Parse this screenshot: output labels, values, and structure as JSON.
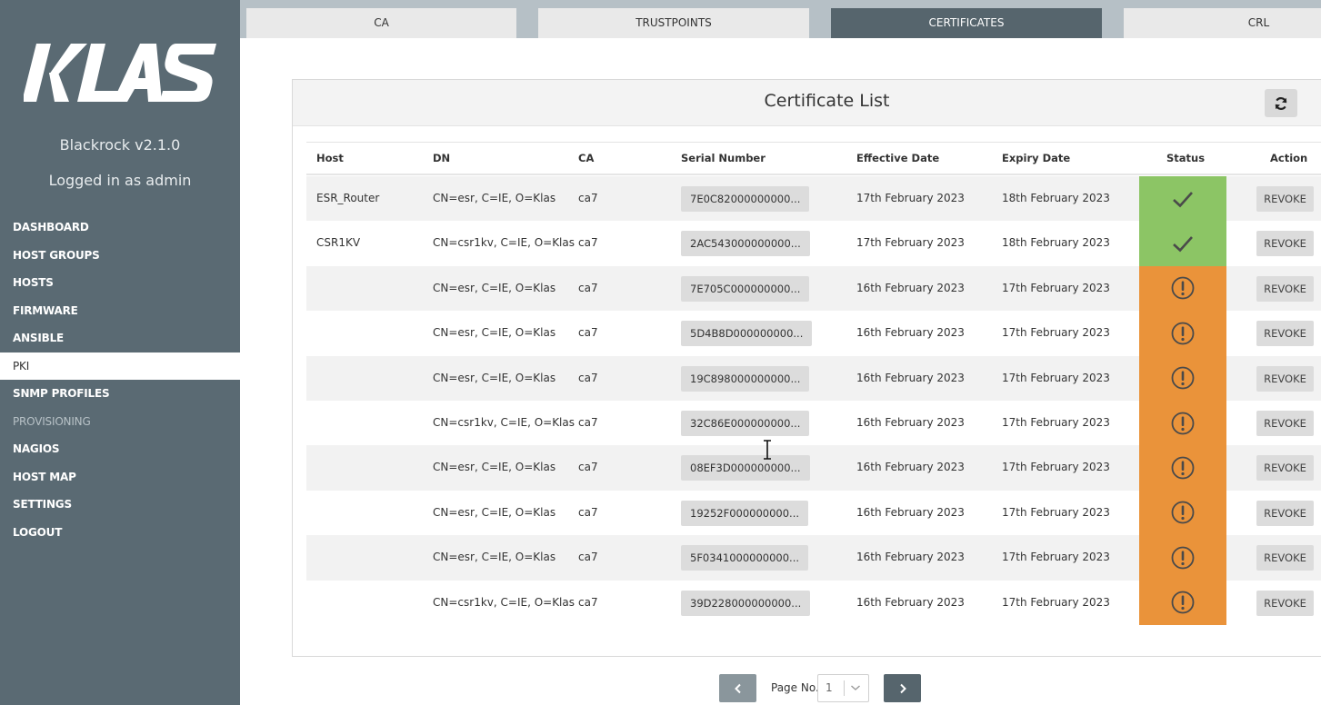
{
  "brand": {
    "logo_text": "KLAS",
    "version": "Blackrock v2.1.0",
    "login": "Logged in as admin"
  },
  "nav": [
    {
      "label": "DASHBOARD"
    },
    {
      "label": "HOST GROUPS"
    },
    {
      "label": "HOSTS"
    },
    {
      "label": "FIRMWARE"
    },
    {
      "label": "ANSIBLE"
    },
    {
      "label": "PKI",
      "active": true
    },
    {
      "label": "SNMP PROFILES"
    },
    {
      "label": "PROVISIONING",
      "disabled": true
    },
    {
      "label": "NAGIOS"
    },
    {
      "label": "HOST MAP"
    },
    {
      "label": "SETTINGS"
    },
    {
      "label": "LOGOUT"
    }
  ],
  "tabs": [
    {
      "label": "CA"
    },
    {
      "label": "TRUSTPOINTS"
    },
    {
      "label": "CERTIFICATES",
      "active": true
    },
    {
      "label": "CRL"
    }
  ],
  "card": {
    "title": "Certificate List",
    "refresh_icon": "refresh-icon"
  },
  "table": {
    "headers": [
      "Host",
      "DN",
      "CA",
      "Serial Number",
      "Effective Date",
      "Expiry Date",
      "Status",
      "Action"
    ],
    "rows": [
      {
        "host": "ESR_Router",
        "dn": "CN=esr, C=IE, O=Klas",
        "ca": "ca7",
        "serial": "7E0C82000000000...",
        "effective": "17th February 2023",
        "expiry": "18th February 2023",
        "status": "valid",
        "action": "REVOKE"
      },
      {
        "host": "CSR1KV",
        "dn": "CN=csr1kv, C=IE, O=Klas",
        "ca": "ca7",
        "serial": "2AC543000000000...",
        "effective": "17th February 2023",
        "expiry": "18th February 2023",
        "status": "valid",
        "action": "REVOKE"
      },
      {
        "host": "",
        "dn": "CN=esr, C=IE, O=Klas",
        "ca": "ca7",
        "serial": "7E705C000000000...",
        "effective": "16th February 2023",
        "expiry": "17th February 2023",
        "status": "warning",
        "action": "REVOKE"
      },
      {
        "host": "",
        "dn": "CN=esr, C=IE, O=Klas",
        "ca": "ca7",
        "serial": "5D4B8D000000000...",
        "effective": "16th February 2023",
        "expiry": "17th February 2023",
        "status": "warning",
        "action": "REVOKE"
      },
      {
        "host": "",
        "dn": "CN=esr, C=IE, O=Klas",
        "ca": "ca7",
        "serial": "19C898000000000...",
        "effective": "16th February 2023",
        "expiry": "17th February 2023",
        "status": "warning",
        "action": "REVOKE"
      },
      {
        "host": "",
        "dn": "CN=csr1kv, C=IE, O=Klas",
        "ca": "ca7",
        "serial": "32C86E000000000...",
        "effective": "16th February 2023",
        "expiry": "17th February 2023",
        "status": "warning",
        "action": "REVOKE"
      },
      {
        "host": "",
        "dn": "CN=esr, C=IE, O=Klas",
        "ca": "ca7",
        "serial": "08EF3D000000000...",
        "effective": "16th February 2023",
        "expiry": "17th February 2023",
        "status": "warning",
        "action": "REVOKE"
      },
      {
        "host": "",
        "dn": "CN=esr, C=IE, O=Klas",
        "ca": "ca7",
        "serial": "19252F000000000...",
        "effective": "16th February 2023",
        "expiry": "17th February 2023",
        "status": "warning",
        "action": "REVOKE"
      },
      {
        "host": "",
        "dn": "CN=esr, C=IE, O=Klas",
        "ca": "ca7",
        "serial": "5F0341000000000...",
        "effective": "16th February 2023",
        "expiry": "17th February 2023",
        "status": "warning",
        "action": "REVOKE"
      },
      {
        "host": "",
        "dn": "CN=csr1kv, C=IE, O=Klas",
        "ca": "ca7",
        "serial": "39D228000000000...",
        "effective": "16th February 2023",
        "expiry": "17th February 2023",
        "status": "warning",
        "action": "REVOKE"
      }
    ]
  },
  "pagination": {
    "label": "Page No.",
    "value": "1",
    "prev_icon": "chevron-left-icon",
    "next_icon": "chevron-right-icon"
  },
  "colors": {
    "sidebar": "#5a6a73",
    "tab_active": "#56656d",
    "status_ok": "#8cc565",
    "status_warn": "#ea933a"
  }
}
